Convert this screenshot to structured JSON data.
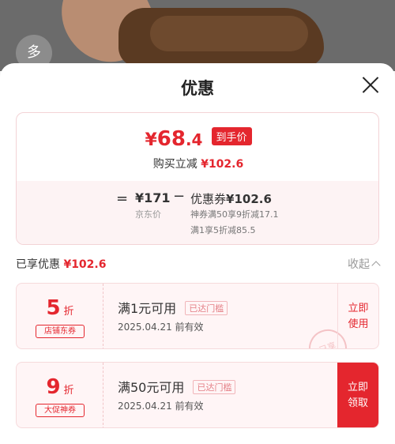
{
  "background": {
    "more_label": "多"
  },
  "sheet": {
    "title": "优惠"
  },
  "summary": {
    "price_currency": "¥",
    "price_integer": "68",
    "price_decimal": ".4",
    "price_tag": "到手价",
    "subtract_label": "购买立减",
    "subtract_amount": "¥102.6",
    "equals": "=",
    "base_price": "¥171",
    "base_label": "京东价",
    "minus": "−",
    "coupon_label": "优惠券",
    "coupon_amount": "¥102.6",
    "detail_line1": "神券满50享9折减17.1",
    "detail_line2": "满1享5折减85.5"
  },
  "enjoyed": {
    "label": "已享优惠",
    "amount": "¥102.6",
    "collapse_label": "收起"
  },
  "coupons": [
    {
      "discount": "5",
      "unit": "折",
      "kind": "店铺东券",
      "condition": "满1元可用",
      "status": "已达门槛",
      "expire": "2025.04.21 前有效",
      "action": "立即使用",
      "stamp": "已享"
    },
    {
      "discount": "9",
      "unit": "折",
      "kind": "大促神券",
      "condition": "满50元可用",
      "status": "已达门槛",
      "expire": "2025.04.21 前有效",
      "action": "立即领取"
    }
  ],
  "colors": {
    "accent": "#e4262e",
    "light_pink": "#fff5f6"
  }
}
